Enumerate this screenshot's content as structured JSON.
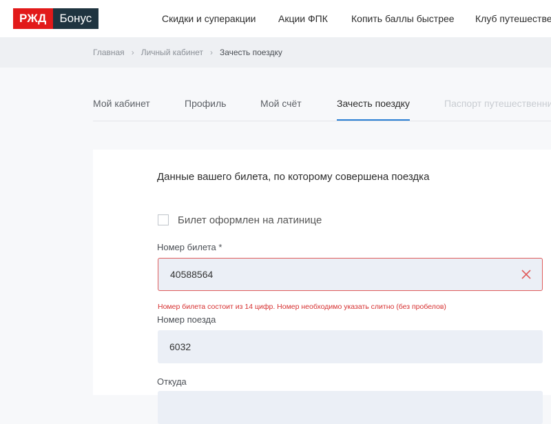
{
  "logo": {
    "part1": "РЖД",
    "part2": "Бонус"
  },
  "nav": [
    {
      "label": "Скидки и суперакции"
    },
    {
      "label": "Акции ФПК"
    },
    {
      "label": "Копить баллы быстрее"
    },
    {
      "label": "Клуб путешественников"
    }
  ],
  "breadcrumb": {
    "items": [
      "Главная",
      "Личный кабинет"
    ],
    "current": "Зачесть поездку",
    "separator": "›"
  },
  "tabs": [
    {
      "label": "Мой кабинет"
    },
    {
      "label": "Профиль"
    },
    {
      "label": "Мой счёт"
    },
    {
      "label": "Зачесть поездку",
      "active": true
    },
    {
      "label": "Паспорт путешественника",
      "disabled": true
    }
  ],
  "form": {
    "heading": "Данные вашего билета, по которому совершена поездка",
    "latin_checkbox": {
      "label": "Билет оформлен на латинице",
      "checked": false
    },
    "ticket_number": {
      "label": "Номер билета *",
      "value": "40588564",
      "error": "Номер билета состоит из 14 цифр. Номер необходимо указать слитно (без пробелов)"
    },
    "train_number": {
      "label": "Номер поезда",
      "value": "6032"
    },
    "from": {
      "label": "Откуда",
      "value": ""
    }
  },
  "colors": {
    "brand_red": "#e21a1a",
    "brand_dark": "#1f3440",
    "active_tab": "#2a7fd4",
    "error": "#d63030"
  }
}
